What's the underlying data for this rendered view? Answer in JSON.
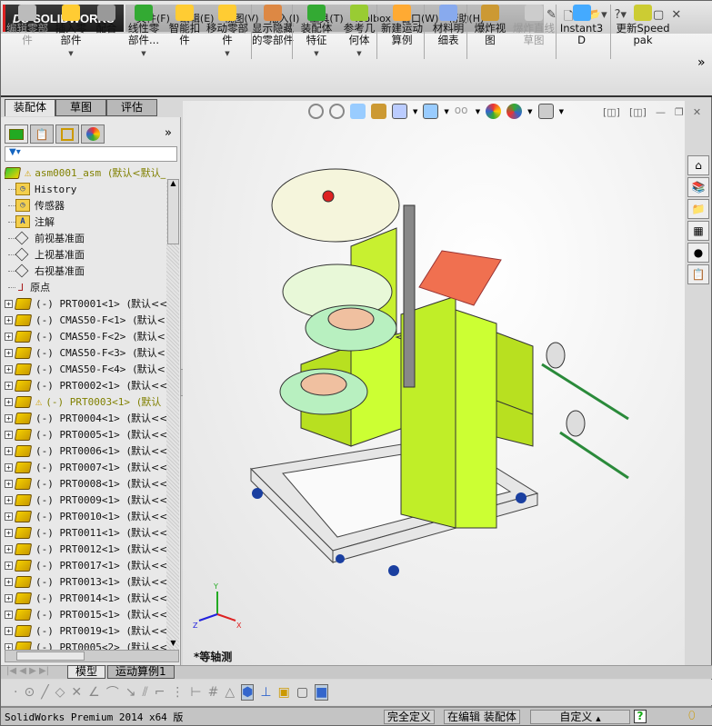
{
  "app": {
    "logo": "SOLIDWORKS"
  },
  "menu": [
    "文件(F)",
    "编辑(E)",
    "视图(V)",
    "插入(I)",
    "工具(T)",
    "Toolbox",
    "窗口(W)",
    "帮助(H)"
  ],
  "ribbon": [
    {
      "label": "编辑零部件",
      "disabled": true
    },
    {
      "label": "插入零部件",
      "dropdown": true
    },
    {
      "label": "配合"
    },
    {
      "label": "线性零部件...",
      "dropdown": true
    },
    {
      "label": "智能扣件"
    },
    {
      "label": "移动零部件",
      "dropdown": true
    },
    {
      "label": "显示隐藏的零部件"
    },
    {
      "label": "装配体特征",
      "dropdown": true
    },
    {
      "label": "参考几何体",
      "dropdown": true
    },
    {
      "label": "新建运动算例"
    },
    {
      "label": "材料明细表"
    },
    {
      "label": "爆炸视图"
    },
    {
      "label": "爆炸直线草图",
      "disabled": true
    },
    {
      "label": "Instant3D"
    },
    {
      "label": "更新Speedpak"
    }
  ],
  "left_tabs": [
    "装配体",
    "草图",
    "评估"
  ],
  "tree": [
    {
      "text": "asm0001_asm",
      "config": "(默认<默认_",
      "icon": "assembly",
      "warn": true,
      "olive": true
    },
    {
      "text": "History",
      "icon": "folder-history"
    },
    {
      "text": "传感器",
      "icon": "folder-sensor"
    },
    {
      "text": "注解",
      "icon": "folder-annotation",
      "expand": true
    },
    {
      "text": "前视基准面",
      "icon": "plane"
    },
    {
      "text": "上视基准面",
      "icon": "plane"
    },
    {
      "text": "右视基准面",
      "icon": "plane"
    },
    {
      "text": "原点",
      "icon": "origin"
    },
    {
      "text": "(-) PRT0001<1>",
      "config": "(默认<<",
      "icon": "part",
      "expand": true
    },
    {
      "text": "(-) CMAS50-F<1>",
      "config": "(默认<<",
      "icon": "part",
      "expand": true
    },
    {
      "text": "(-) CMAS50-F<2>",
      "config": "(默认<<",
      "icon": "part",
      "expand": true
    },
    {
      "text": "(-) CMAS50-F<3>",
      "config": "(默认<<",
      "icon": "part",
      "expand": true
    },
    {
      "text": "(-) CMAS50-F<4>",
      "config": "(默认<<",
      "icon": "part",
      "expand": true
    },
    {
      "text": "(-) PRT0002<1>",
      "config": "(默认<<",
      "icon": "part",
      "expand": true
    },
    {
      "text": "(-) PRT0003<1>",
      "config": "(默认",
      "icon": "part",
      "expand": true,
      "warn": true,
      "olive": true
    },
    {
      "text": "(-) PRT0004<1>",
      "config": "(默认<<",
      "icon": "part",
      "expand": true
    },
    {
      "text": "(-) PRT0005<1>",
      "config": "(默认<<",
      "icon": "part",
      "expand": true
    },
    {
      "text": "(-) PRT0006<1>",
      "config": "(默认<<",
      "icon": "part",
      "expand": true
    },
    {
      "text": "(-) PRT0007<1>",
      "config": "(默认<<",
      "icon": "part",
      "expand": true
    },
    {
      "text": "(-) PRT0008<1>",
      "config": "(默认<<",
      "icon": "part",
      "expand": true
    },
    {
      "text": "(-) PRT0009<1>",
      "config": "(默认<<",
      "icon": "part",
      "expand": true
    },
    {
      "text": "(-) PRT0010<1>",
      "config": "(默认<<",
      "icon": "part",
      "expand": true
    },
    {
      "text": "(-) PRT0011<1>",
      "config": "(默认<<",
      "icon": "part",
      "expand": true
    },
    {
      "text": "(-) PRT0012<1>",
      "config": "(默认<<",
      "icon": "part",
      "expand": true
    },
    {
      "text": "(-) PRT0017<1>",
      "config": "(默认<<",
      "icon": "part",
      "expand": true
    },
    {
      "text": "(-) PRT0013<1>",
      "config": "(默认<<",
      "icon": "part",
      "expand": true
    },
    {
      "text": "(-) PRT0014<1>",
      "config": "(默认<<",
      "icon": "part",
      "expand": true
    },
    {
      "text": "(-) PRT0015<1>",
      "config": "(默认<<",
      "icon": "part",
      "expand": true
    },
    {
      "text": "(-) PRT0019<1>",
      "config": "(默认<<",
      "icon": "part",
      "expand": true
    },
    {
      "text": "(-) PRT0005<2>",
      "config": "(默认<<",
      "icon": "part",
      "expand": true
    }
  ],
  "viewport": {
    "view_name": "*等轴测",
    "triad": {
      "x": "X",
      "y": "Y",
      "z": "Z"
    },
    "model_color": "#ccff33"
  },
  "bottom_tabs": [
    "模型",
    "运动算例1"
  ],
  "status": {
    "product": "SolidWorks Premium 2014 x64 版",
    "state": "完全定义",
    "editing": "在编辑 装配体",
    "units": "自定义"
  }
}
